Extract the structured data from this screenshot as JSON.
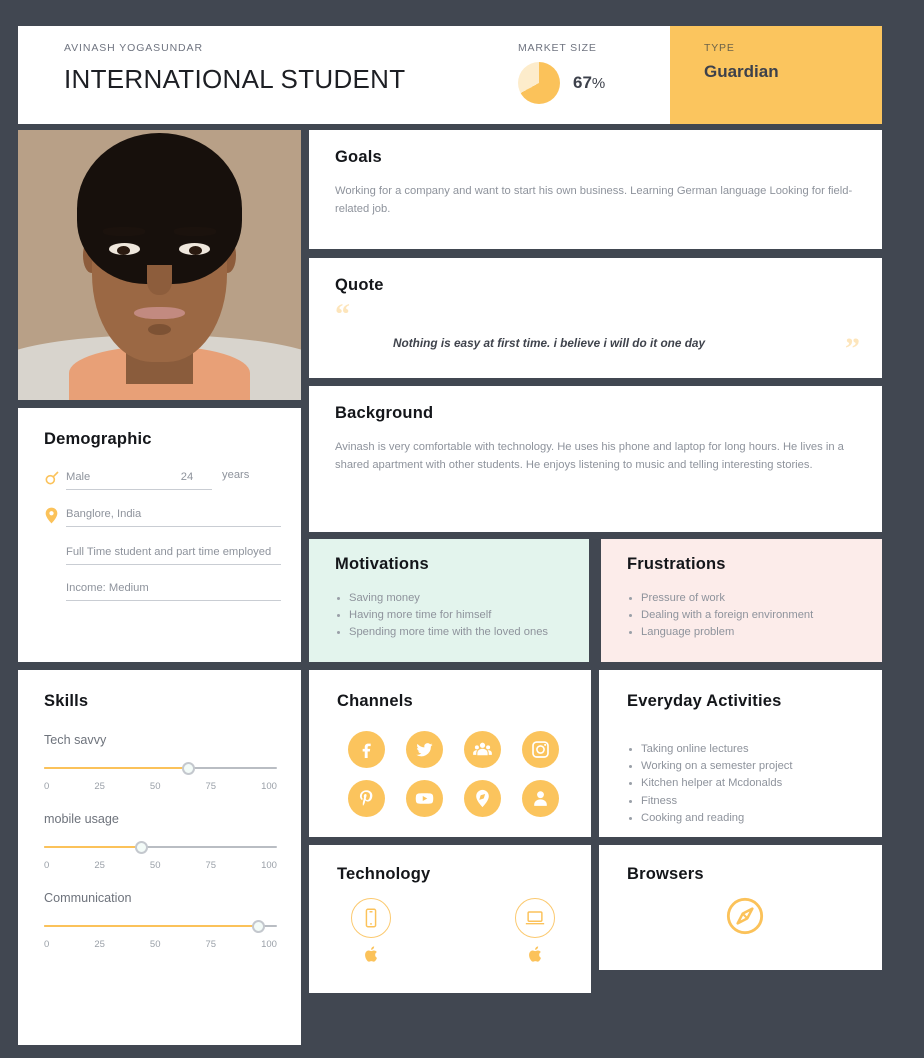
{
  "header": {
    "eyebrow": "AVINASH YOGASUNDAR",
    "title": "INTERNATIONAL STUDENT",
    "market_label": "MARKET SIZE",
    "market_value": "67",
    "market_unit": "%",
    "market_percent": 67,
    "type_label": "TYPE",
    "type_value": "Guardian",
    "accent_color": "#fbc55e",
    "pie_fill_color": "#fbc25a",
    "pie_rest_color": "#fdeccb"
  },
  "goals": {
    "title": "Goals",
    "text": "Working for a company and want to start his own business. Learning German language Looking for field-related job."
  },
  "quote": {
    "title": "Quote",
    "open_mark": "“",
    "close_mark": "”",
    "text": "Nothing is easy at first time. i believe i will do it one day"
  },
  "background": {
    "title": "Background",
    "text": "Avinash is very comfortable with technology. He uses his phone and laptop for long hours. He lives in a shared apartment with other students. He enjoys listening to music and telling interesting stories."
  },
  "demographic": {
    "title": "Demographic",
    "gender": "Male",
    "age": "24",
    "age_unit": "years",
    "location": "Banglore, India",
    "occupation": "Full Time student and part time employed",
    "income": "Income: Medium"
  },
  "motivations": {
    "title": "Motivations",
    "bg_color": "#e3f4ed",
    "items": [
      "Saving money",
      "Having more time for himself",
      "Spending more time with the loved ones"
    ]
  },
  "frustrations": {
    "title": "Frustrations",
    "bg_color": "#fcecea",
    "items": [
      "Pressure of work",
      "Dealing with a foreign environment",
      "Language problem"
    ]
  },
  "skills": {
    "title": "Skills",
    "tick_labels": [
      "0",
      "25",
      "50",
      "75",
      "100"
    ],
    "items": [
      {
        "label": "Tech savvy",
        "value": 62
      },
      {
        "label": "mobile usage",
        "value": 42
      },
      {
        "label": "Communication",
        "value": 92
      }
    ]
  },
  "channels": {
    "title": "Channels",
    "items": [
      {
        "name": "facebook"
      },
      {
        "name": "twitter"
      },
      {
        "name": "group"
      },
      {
        "name": "instagram"
      },
      {
        "name": "pinterest"
      },
      {
        "name": "youtube"
      },
      {
        "name": "location"
      },
      {
        "name": "person"
      }
    ]
  },
  "activities": {
    "title": "Everyday Activities",
    "items": [
      "Taking online lectures",
      "Working on a semester project",
      "Kitchen helper at Mcdonalds",
      "Fitness",
      "Cooking and reading"
    ]
  },
  "technology": {
    "title": "Technology",
    "items": [
      {
        "device": "smartphone",
        "brand": "apple"
      },
      {
        "device": "laptop",
        "brand": "apple"
      }
    ]
  },
  "browsers": {
    "title": "Browsers",
    "items": [
      {
        "name": "safari"
      }
    ]
  }
}
